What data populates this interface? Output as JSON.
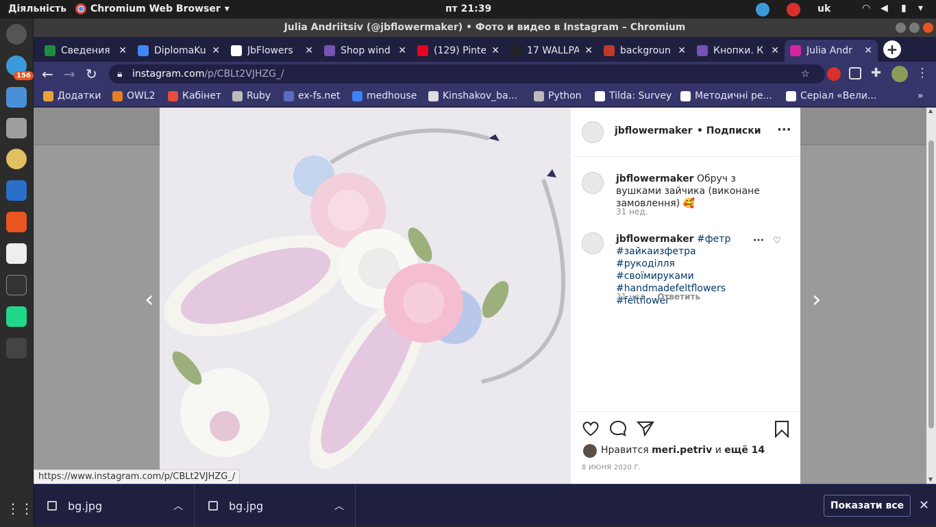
{
  "topbar": {
    "activities": "Діяльність",
    "app_name": "Chromium Web Browser",
    "clock": "пт 21:39",
    "language": "uk",
    "telegram_badge": "156"
  },
  "window": {
    "title": "Julia Andriitsiv (@jbflowermaker) • Фото и видео в Instagram – Chromium"
  },
  "tabs": [
    {
      "label": "Сведения",
      "color": "#1e8e3e"
    },
    {
      "label": "DiplomaKu",
      "color": "#4285f4"
    },
    {
      "label": "JbFlowers",
      "color": "#ffffff"
    },
    {
      "label": "Shop wind",
      "color": "#7952b3"
    },
    {
      "label": "(129) Pinte",
      "color": "#e60023"
    },
    {
      "label": "17 WALLPA",
      "color": "#222222"
    },
    {
      "label": "backgroun",
      "color": "#c0392b"
    },
    {
      "label": "Кнопки. К",
      "color": "#7952b3"
    },
    {
      "label": "Julia Andr",
      "color": "#d6249f"
    }
  ],
  "omnibox": {
    "host": "instagram.com",
    "path": "/p/CBLt2VJHZG_/"
  },
  "bookmarks": [
    {
      "label": "Додатки",
      "color": "#e9a23b"
    },
    {
      "label": "OWL2",
      "color": "#e67e22"
    },
    {
      "label": "Кабінет",
      "color": "#e74c3c"
    },
    {
      "label": "Ruby",
      "color": "#bbbbbb"
    },
    {
      "label": "ex-fs.net",
      "color": "#5c6bc0"
    },
    {
      "label": "medhouse",
      "color": "#3b82f6"
    },
    {
      "label": "Kinshakov_ba...",
      "color": "#dddddd"
    },
    {
      "label": "Python",
      "color": "#bbbbbb"
    },
    {
      "label": "Tilda: Survey",
      "color": "#ffffff"
    },
    {
      "label": "Методичні ре...",
      "color": "#ffffff"
    },
    {
      "label": "Серіал «Вели...",
      "color": "#ffffff"
    }
  ],
  "post": {
    "header_username": "jbflowermaker",
    "header_follow": "• Подписки",
    "comments": [
      {
        "username": "jbflowermaker",
        "text": "Обруч з вушками зайчика (виконане замовлення) 🥰",
        "age": "31 нед.",
        "reply": ""
      },
      {
        "username": "jbflowermaker",
        "text": "#фетр #зайкаизфетра #рукоділля #своїмируками #handmadefeltflowers #feltflower",
        "age": "31 нед.",
        "reply": "Ответить"
      }
    ],
    "likes_prefix": "Нравится",
    "likes_user": "meri.petriv",
    "likes_and": "и",
    "likes_more": "ещё 14",
    "date": "8 ИЮНЯ 2020 Г."
  },
  "status_link": "https://www.instagram.com/p/CBLt2VJHZG_/",
  "downloads": {
    "items": [
      "bg.jpg",
      "bg.jpg"
    ],
    "show_all": "Показати все"
  }
}
